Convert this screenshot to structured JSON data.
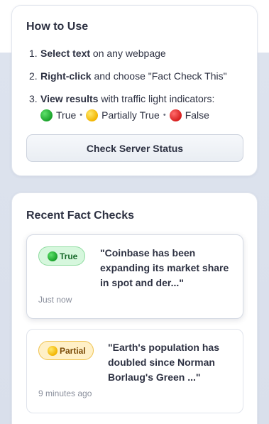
{
  "how_to_use": {
    "title": "How to Use",
    "steps": [
      {
        "number": "1.",
        "bold": "Select text",
        "rest": " on any webpage"
      },
      {
        "number": "2.",
        "bold": "Right-click",
        "rest": " and choose \"Fact Check This\""
      },
      {
        "number": "3.",
        "bold": "View results",
        "rest": " with traffic light indicators:"
      }
    ],
    "legend": {
      "true_label": "True",
      "partial_label": "Partially True",
      "false_label": "False",
      "separator": "•"
    },
    "status_button_label": "Check Server Status"
  },
  "recent": {
    "title": "Recent Fact Checks",
    "items": [
      {
        "verdict": "True",
        "verdict_color": "#17692a",
        "claim": "\"Coinbase has been expanding its market share in spot and der...\"",
        "time": "Just now"
      },
      {
        "verdict": "Partial",
        "verdict_color": "#7a4a06",
        "claim": "\"Earth's population has doubled since Norman Borlaug's Green ...\"",
        "time": "9 minutes ago"
      }
    ]
  },
  "colors": {
    "true": "#19a22a",
    "partial": "#f2b400",
    "false": "#d61e1e"
  }
}
